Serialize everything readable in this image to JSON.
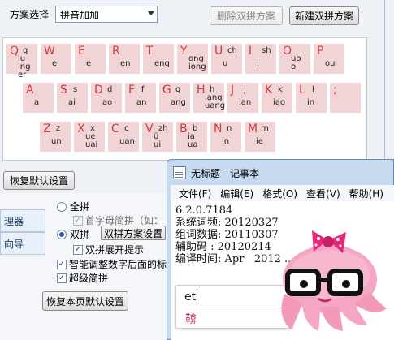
{
  "scheme_dialog": {
    "scheme_label": "方案选择",
    "scheme_value": "拼音加加",
    "delete_button": "删除双拼方案",
    "new_button": "新建双拼方案",
    "restore_button": "恢复默认设置",
    "keyboard": {
      "rows": [
        [
          {
            "letter": "Q",
            "top": "q",
            "bottom": "iu ing er"
          },
          {
            "letter": "W",
            "top": "",
            "bottom": "ei"
          },
          {
            "letter": "E",
            "top": "",
            "bottom": "e"
          },
          {
            "letter": "R",
            "top": "",
            "bottom": "en"
          },
          {
            "letter": "T",
            "top": "",
            "bottom": "eng"
          },
          {
            "letter": "Y",
            "top": "",
            "bottom": "ong iong"
          },
          {
            "letter": "U",
            "top": "ch",
            "bottom": "u"
          },
          {
            "letter": "I",
            "top": "sh",
            "bottom": "i"
          },
          {
            "letter": "O",
            "top": "",
            "bottom": "uo o"
          },
          {
            "letter": "P",
            "top": "",
            "bottom": "ou"
          }
        ],
        [
          {
            "letter": "A",
            "top": "",
            "bottom": "a"
          },
          {
            "letter": "S",
            "top": "s",
            "bottom": "ai"
          },
          {
            "letter": "D",
            "top": "d",
            "bottom": "ao"
          },
          {
            "letter": "F",
            "top": "f",
            "bottom": "an"
          },
          {
            "letter": "G",
            "top": "g",
            "bottom": "ang"
          },
          {
            "letter": "H",
            "top": "h",
            "bottom": "iang uang"
          },
          {
            "letter": "J",
            "top": "j",
            "bottom": "ian"
          },
          {
            "letter": "K",
            "top": "k",
            "bottom": "iao"
          },
          {
            "letter": "L",
            "top": "l",
            "bottom": "in"
          },
          {
            "letter": ";",
            "top": "",
            "bottom": ""
          }
        ],
        [
          {
            "letter": "Z",
            "top": "z",
            "bottom": "un"
          },
          {
            "letter": "X",
            "top": "x",
            "bottom": "ue uai"
          },
          {
            "letter": "C",
            "top": "c",
            "bottom": "uan"
          },
          {
            "letter": "V",
            "top": "zh",
            "bottom": "ü ui"
          },
          {
            "letter": "B",
            "top": "b",
            "bottom": "ia ua"
          },
          {
            "letter": "N",
            "top": "n",
            "bottom": "in"
          },
          {
            "letter": "M",
            "top": "m",
            "bottom": "ie"
          }
        ]
      ]
    }
  },
  "settings_panel": {
    "side_items": [
      "理器",
      "向导"
    ],
    "options": {
      "full_pinyin": "全拼",
      "initial_abbrev": "首字母简拼（如：",
      "shuangpin": "双拼",
      "shuangpin_scheme_button": "双拼方案设置",
      "shuangpin_hint": "双拼展开提示",
      "smart_adjust": "智能调整数字后面的标",
      "super_abbrev": "超级简拼"
    },
    "restore_page_button": "恢复本页默认设置"
  },
  "notepad": {
    "title": "无标题 - 记事本",
    "menu": [
      "文件(F)",
      "编辑(E)",
      "格式(O)",
      "查看(V)",
      "帮助(H)"
    ],
    "content_lines": [
      "6.2.0.7184",
      "系统词频: 20120327",
      "组词数据: 20110307",
      "辅助码 : 20120214",
      "编译时间: Apr   2012 ... 26"
    ]
  },
  "ime": {
    "composition": "et",
    "candidate": "鞥"
  },
  "colors": {
    "key_bg": "#f0d4d6",
    "key_letter": "#d23a3a",
    "mascot_pink": "#f09ab8"
  }
}
